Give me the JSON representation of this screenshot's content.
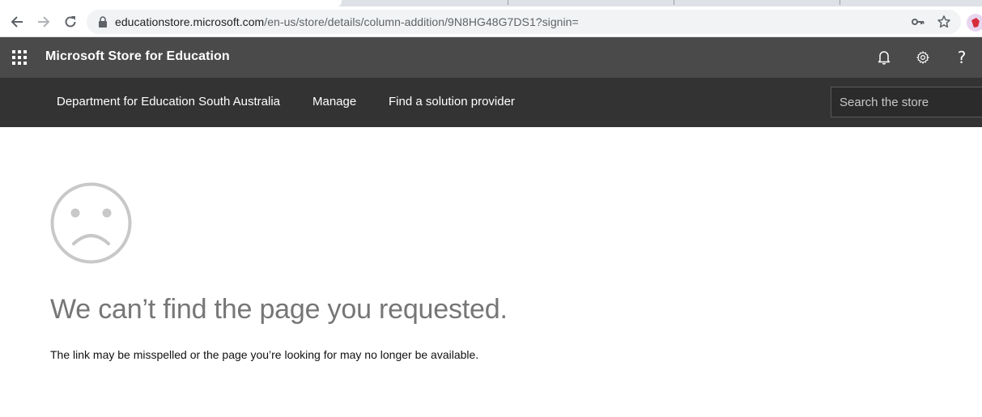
{
  "browser": {
    "url_host": "educationstore.microsoft.com",
    "url_path": "/en-us/store/details/column-addition/9N8HG48G7DS1?signin=",
    "icons": [
      "back-arrow-icon",
      "forward-arrow-icon",
      "reload-icon",
      "lock-icon",
      "key-icon",
      "star-icon",
      "profile-avatar"
    ]
  },
  "header": {
    "title": "Microsoft Store for Education",
    "icons": [
      "app-launcher-icon",
      "bell-icon",
      "gear-icon",
      "help-icon"
    ],
    "help_glyph": "?"
  },
  "nav": {
    "items": [
      {
        "label": "Department for Education South Australia"
      },
      {
        "label": "Manage"
      },
      {
        "label": "Find a solution provider"
      }
    ],
    "search_placeholder": "Search the store"
  },
  "error": {
    "title": "We can’t find the page you requested.",
    "message": "The link may be misspelled or the page you’re looking for may no longer be available.",
    "icon": "sad-face-icon"
  },
  "colors": {
    "header_bg": "#4a4a4a",
    "nav_bg": "#333333",
    "error_title": "#767676",
    "sad_face": "#c8c8c8"
  }
}
